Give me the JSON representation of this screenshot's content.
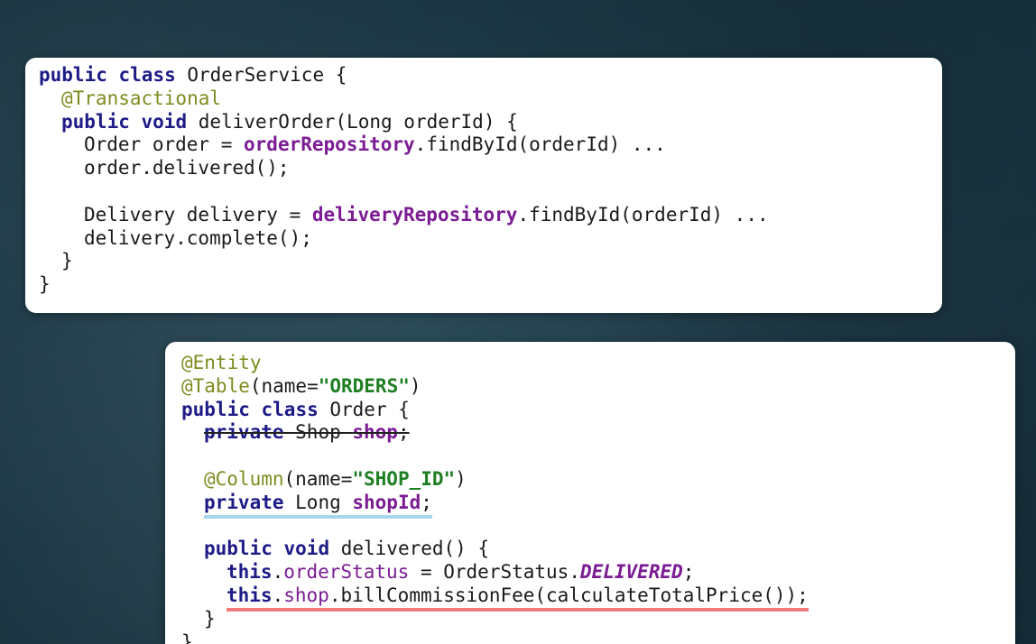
{
  "service_card": {
    "lines": [
      {
        "t1": "public",
        "t2": " ",
        "t3": "class",
        "t4": " OrderService {"
      },
      {
        "ann": "@Transactional"
      },
      {
        "t1": "public",
        "t2": " ",
        "t3": "void",
        "t4": " deliverOrder(Long orderId) {"
      },
      {
        "pre": "Order order = ",
        "field": "orderRepository",
        "post": ".findById(orderId) ..."
      },
      {
        "text": "order.delivered();"
      },
      {
        "text": ""
      },
      {
        "pre": "Delivery delivery = ",
        "field": "deliveryRepository",
        "post": ".findById(orderId) ..."
      },
      {
        "text": "delivery.complete();"
      },
      {
        "text": "}"
      },
      {
        "text": "}"
      }
    ]
  },
  "entity_card": {
    "entity_ann": "@Entity",
    "table_ann": "@Table",
    "table_open": "(name=",
    "table_value": "\"ORDERS\"",
    "table_close": ")",
    "class_kw1": "public",
    "class_kw2": "class",
    "class_rest": " Order {",
    "old_field": {
      "kw": "private",
      "type": " Shop ",
      "name": "shop",
      "end": ";"
    },
    "column_ann": "@Column",
    "column_open": "(name=",
    "column_value": "\"SHOP_ID\"",
    "column_close": ")",
    "new_field": {
      "kw": "private",
      "type": " Long ",
      "name": "shopId",
      "end": ";"
    },
    "method_kw1": "public",
    "method_kw2": "void",
    "method_rest": " delivered() {",
    "status_this": "this",
    "status_dot": ".",
    "status_field": "orderStatus",
    "status_mid": " = OrderStatus.",
    "status_const": "DELIVERED",
    "status_end": ";",
    "bill_this": "this",
    "bill_dot": ".",
    "bill_field": "shop",
    "bill_rest": ".billCommissionFee(calculateTotalPrice());",
    "close_method": "}",
    "close_class": "}"
  },
  "colors": {
    "keyword": "#1d1b86",
    "annotation": "#7f8b1f",
    "field": "#7b1c93",
    "string": "#1f7f23",
    "highlight_blue": "#a6d6ec",
    "highlight_red": "#f07a7c"
  }
}
